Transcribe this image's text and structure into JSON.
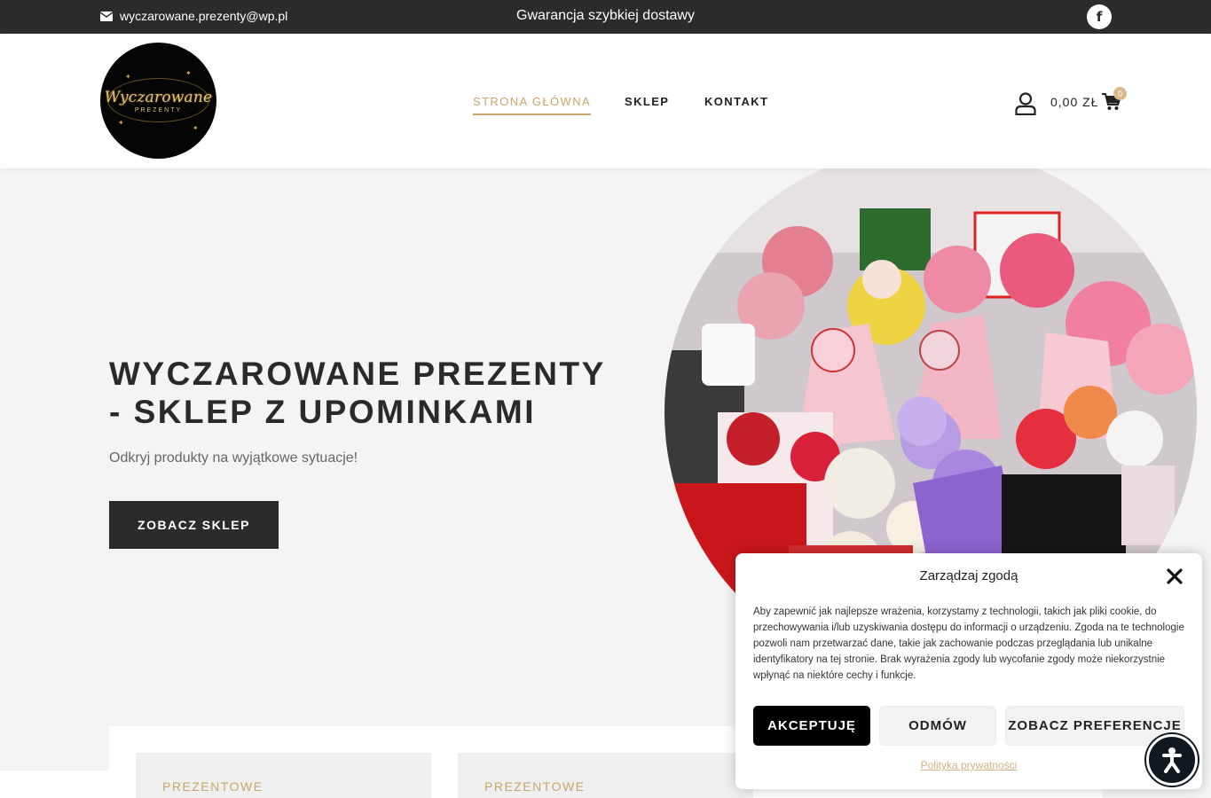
{
  "topbar": {
    "email": "wyczarowane.prezenty@wp.pl",
    "promo": "Gwarancja szybkiej dostawy",
    "social_icon": "facebook-icon",
    "facebook_glyph": "f"
  },
  "header": {
    "logo_text": "Wyczarowane",
    "logo_subtext": "PREZENTY",
    "nav": [
      {
        "label": "STRONA GŁÓWNA",
        "active": true
      },
      {
        "label": "SKLEP",
        "active": false
      },
      {
        "label": "KONTAKT",
        "active": false
      }
    ],
    "cart_total": "0,00 ZŁ",
    "cart_count": "0",
    "icons": [
      "user-icon",
      "cart-icon"
    ]
  },
  "hero": {
    "title": "WYCZAROWANE PREZENTY - SKLEP Z UPOMINKAMI",
    "subtitle": "Odkryj produkty na wyjątkowe sytuacje!",
    "button": "ZOBACZ SKLEP"
  },
  "categories": [
    {
      "label": "PREZENTOWE"
    },
    {
      "label": "PREZENTOWE"
    }
  ],
  "cookie_modal": {
    "title": "Zarządzaj zgodą",
    "body": "Aby zapewnić jak najlepsze wrażenia, korzystamy z technologii, takich jak pliki cookie, do przechowywania i/lub uzyskiwania dostępu do informacji o urządzeniu. Zgoda na te technologie pozwoli nam przetwarzać dane, takie jak zachowanie podczas przeglądania lub unikalne identyfikatory na tej stronie. Brak wyrażenia zgody lub wycofanie zgody może niekorzystnie wpłynąć na niektóre cechy i funkcje.",
    "accept": "AKCEPTUJĘ",
    "deny": "ODMÓW",
    "preferences": "ZOBACZ PREFERENCJE",
    "policy_link": "Polityka prywatności"
  },
  "colors": {
    "accent_gold": "#c9a46b",
    "dark": "#2b2b2b",
    "background": "#f4f4f4"
  }
}
